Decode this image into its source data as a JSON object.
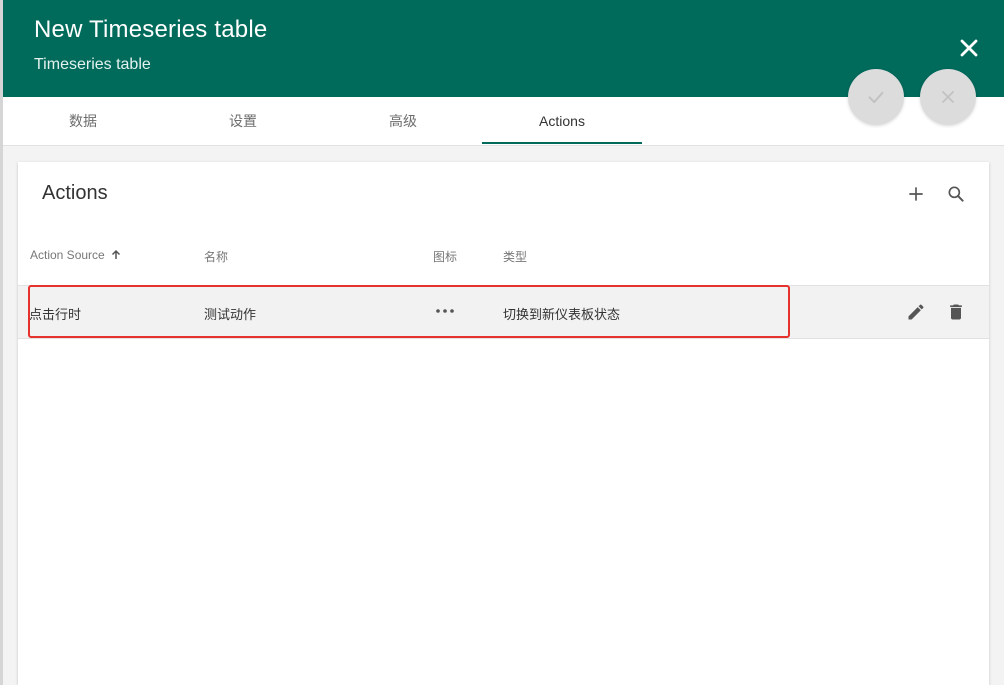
{
  "dialog": {
    "title": "New Timeseries table",
    "subtitle": "Timeseries table",
    "accent_color": "#006a5b"
  },
  "tabs": [
    {
      "label": "数据",
      "active": false
    },
    {
      "label": "设置",
      "active": false
    },
    {
      "label": "高级",
      "active": false
    },
    {
      "label": "Actions",
      "active": true
    }
  ],
  "actions_panel": {
    "title": "Actions",
    "columns": {
      "source": "Action Source",
      "name": "名称",
      "icon": "图标",
      "type": "类型"
    },
    "sort": {
      "column": "source",
      "direction": "ascending"
    },
    "rows": [
      {
        "source": "点击行时",
        "name": "测试动作",
        "icon": "more-horiz-icon",
        "type": "切换到新仪表板状态"
      }
    ],
    "highlight_color": "#e5322d"
  }
}
